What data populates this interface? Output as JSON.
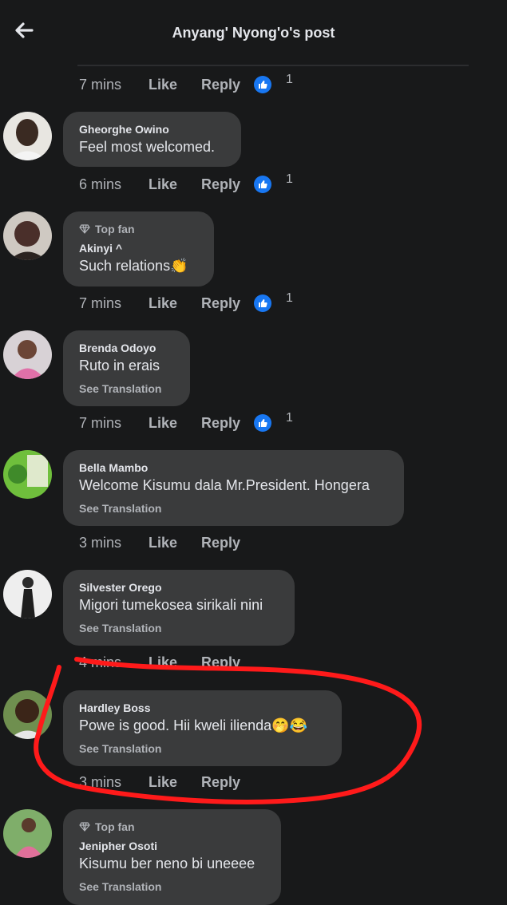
{
  "header": {
    "title": "Anyang' Nyong'o's post"
  },
  "actions": {
    "like": "Like",
    "reply": "Reply"
  },
  "top_meta": {
    "time": "7 mins",
    "reactions": "1"
  },
  "comments": [
    {
      "name": "Gheorghe Owino",
      "text": "Feel most welcomed.",
      "time": "6 mins",
      "reactions": "1"
    },
    {
      "badge": "Top fan",
      "name": "Akinyi ^",
      "text": "Such relations👏",
      "time": "7 mins",
      "reactions": "1"
    },
    {
      "name": "Brenda Odoyo",
      "text": "Ruto in erais",
      "translate": "See Translation",
      "time": "7 mins",
      "reactions": "1"
    },
    {
      "name": "Bella Mambo",
      "text": "Welcome Kisumu dala Mr.President. Hongera",
      "translate": "See Translation",
      "time": "3 mins"
    },
    {
      "name": "Silvester Orego",
      "text": "Migori tumekosea sirikali nini",
      "translate": "See Translation",
      "time": "4 mins"
    },
    {
      "name": "Hardley Boss",
      "text": "Powe is good. Hii kweli ilienda🤭😂",
      "translate": "See Translation",
      "time": "3 mins"
    },
    {
      "badge": "Top fan",
      "name": "Jenipher Osoti",
      "text": "Kisumu ber neno bi uneeee",
      "translate": "See Translation"
    }
  ],
  "colors": {
    "background": "#18191a",
    "bubble": "#3a3b3c",
    "reaction": "#1877f2",
    "annotation": "#ff1a1a"
  },
  "icons": [
    "back-arrow-icon",
    "like-reaction-icon",
    "diamond-icon"
  ]
}
